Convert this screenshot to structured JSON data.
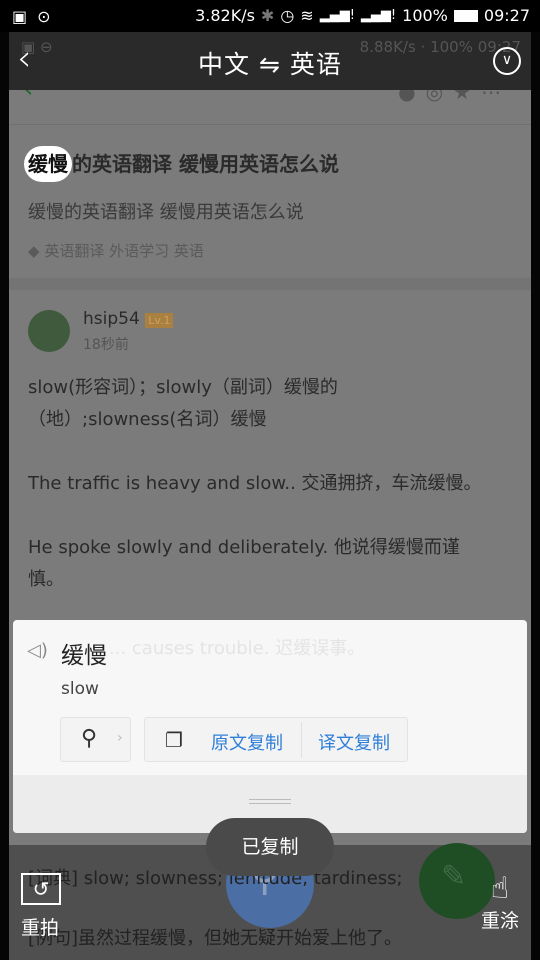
{
  "status_bar": {
    "speed": "3.82K/s",
    "battery": "100%",
    "time": "09:27",
    "icons": [
      "image-icon",
      "more-icon",
      "bluetooth-icon",
      "alarm-icon",
      "wifi-icon",
      "signal-icon",
      "signal-icon",
      "battery-icon"
    ]
  },
  "underlay_status": {
    "speed": "8.88K/s",
    "battery": "100%",
    "time": "09:27"
  },
  "top_bar": {
    "source_lang": "中文",
    "swap": "⇋",
    "target_lang": "英语"
  },
  "article": {
    "title_highlight": "缓慢",
    "title_rest": "的英语翻译 缓慢用英语怎么说",
    "subtitle": "缓慢的英语翻译 缓慢用英语怎么说",
    "tags": "英语翻译 外语学习 英语",
    "user": "hsip54",
    "level": "Lv.1",
    "time": "18秒前",
    "line1": "slow(形容词）；slowly（副词）缓慢的",
    "line2": "（地）;slowness(名词）缓慢",
    "line3": "The traffic is heavy and slow.. 交通拥挤，车流缓慢。",
    "line4": "He spoke slowly and deliberately. 他说得缓慢而谨",
    "line5": "慎。",
    "line6": "... causes trouble. 迟缓误事。",
    "line7": "[词典] slow; slowness; lenitude, tardiness;",
    "line8": "[例句]虽然过程缓慢，但她无疑开始爱上他了。"
  },
  "card": {
    "source": "缓慢",
    "translation": "slow",
    "copy_source": "原文复制",
    "copy_translation": "译文复制"
  },
  "toast": "已复制",
  "bottom": {
    "retake": "重拍",
    "repaint": "重涂"
  },
  "colors": {
    "accent": "#2f7fd8",
    "fab_green": "#1f6b2a"
  }
}
